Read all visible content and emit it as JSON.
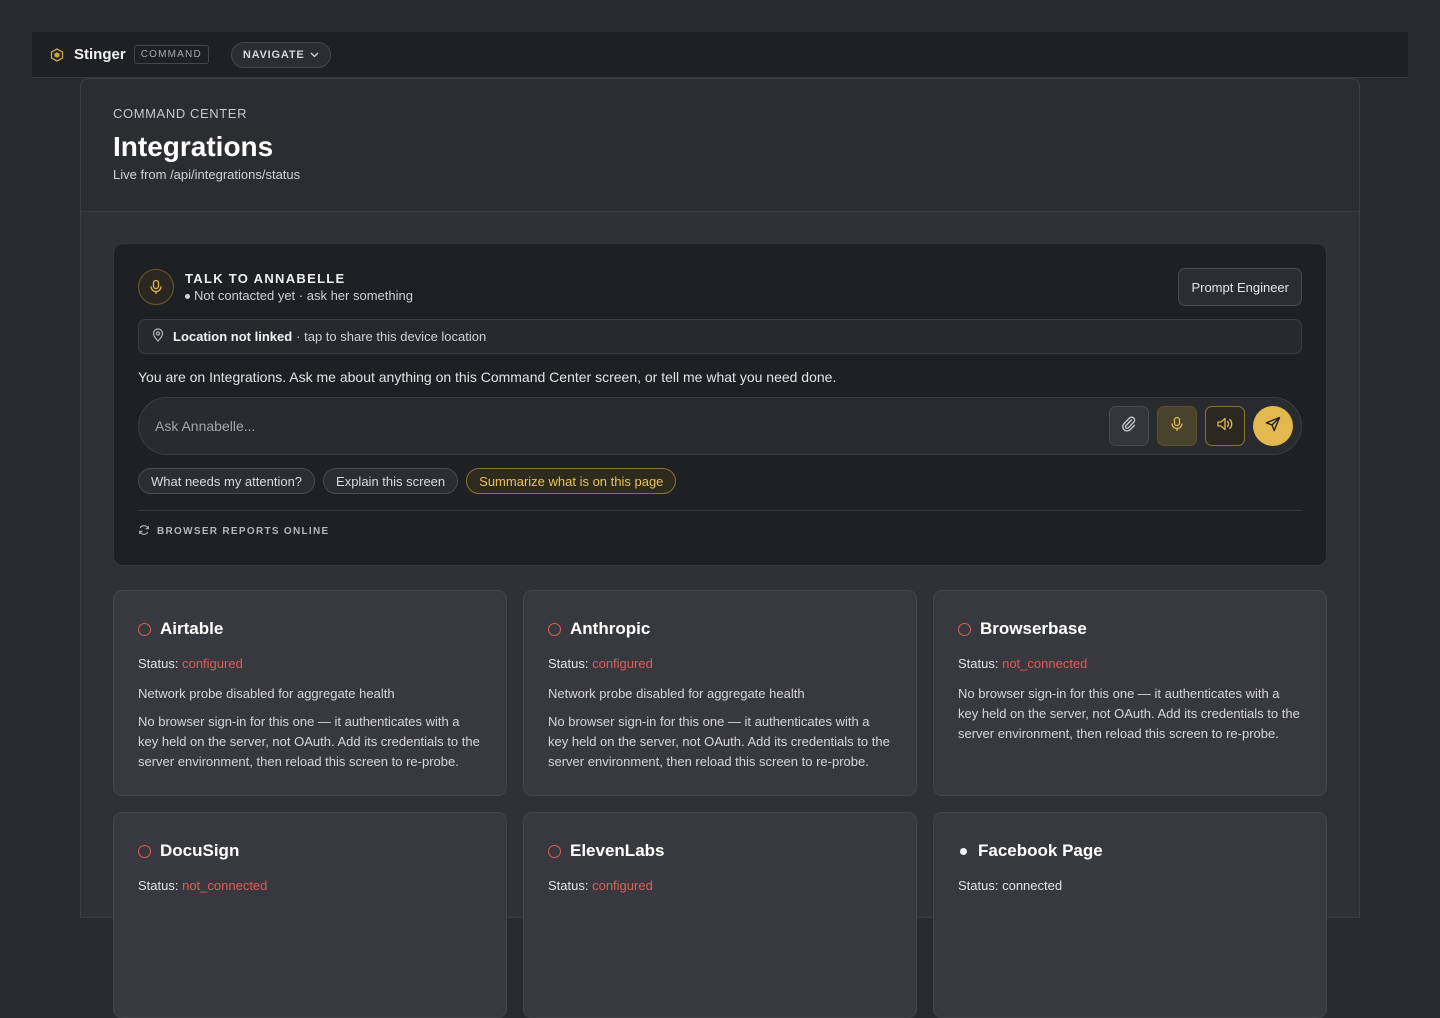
{
  "topbar": {
    "brand": "Stinger",
    "badge": "COMMAND",
    "nav_label": "NAVIGATE",
    "accent": "#e2b84f"
  },
  "header": {
    "eyebrow": "COMMAND CENTER",
    "title": "Integrations",
    "subtitle": "Live from /api/integrations/status"
  },
  "assistant": {
    "title": "TALK TO ANNABELLE",
    "status": "Not contacted yet · ask her something",
    "prompt_button": "Prompt Engineer",
    "location_strong": "Location not linked",
    "location_rest": "· tap to share this device location",
    "context": "You are on Integrations. Ask me about anything on this Command Center screen, or tell me what you need done.",
    "placeholder": "Ask Annabelle...",
    "chips": [
      "What needs my attention?",
      "Explain this screen",
      "Summarize what is on this page"
    ],
    "browser_status": "BROWSER REPORTS ONLINE"
  },
  "integrations": [
    {
      "name": "Airtable",
      "status_label": "Status:",
      "status": "configured",
      "state": "bad",
      "probe": "Network probe disabled for aggregate health",
      "note": "No browser sign-in for this one — it authenticates with a key held on the server, not OAuth. Add its credentials to the server environment, then reload this screen to re-probe."
    },
    {
      "name": "Anthropic",
      "status_label": "Status:",
      "status": "configured",
      "state": "bad",
      "probe": "Network probe disabled for aggregate health",
      "note": "No browser sign-in for this one — it authenticates with a key held on the server, not OAuth. Add its credentials to the server environment, then reload this screen to re-probe."
    },
    {
      "name": "Browserbase",
      "status_label": "Status:",
      "status": "not_connected",
      "state": "bad",
      "note": "No browser sign-in for this one — it authenticates with a key held on the server, not OAuth. Add its credentials to the server environment, then reload this screen to re-probe."
    },
    {
      "name": "DocuSign",
      "status_label": "Status:",
      "status": "not_connected",
      "state": "bad"
    },
    {
      "name": "ElevenLabs",
      "status_label": "Status:",
      "status": "configured",
      "state": "bad"
    },
    {
      "name": "Facebook Page",
      "status_label": "Status:",
      "status": "connected",
      "state": "ok"
    }
  ]
}
